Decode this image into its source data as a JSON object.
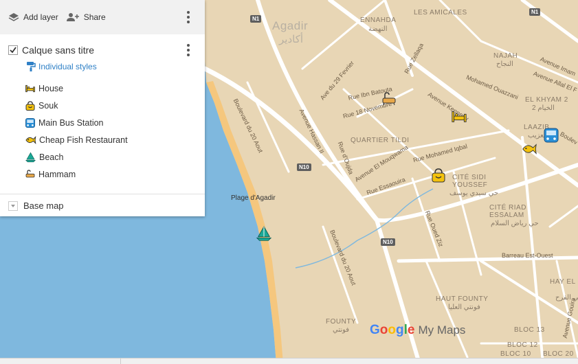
{
  "toolbar": {
    "add_layer_label": "Add layer",
    "share_label": "Share"
  },
  "layer": {
    "title": "Calque sans titre",
    "checked": true,
    "style_label": "Individual styles",
    "items": [
      {
        "label": "House",
        "icon": "bed-icon",
        "color": "#f4c20d"
      },
      {
        "label": "Souk",
        "icon": "shopping-bag-icon",
        "color": "#f4c20d"
      },
      {
        "label": "Main Bus Station",
        "icon": "bus-icon",
        "color": "#2a8fd6"
      },
      {
        "label": "Cheap Fish Restaurant",
        "icon": "fish-icon",
        "color": "#f4c20d"
      },
      {
        "label": "Beach",
        "icon": "sailboat-icon",
        "color": "#1aa896"
      },
      {
        "label": "Hammam",
        "icon": "bath-icon",
        "color": "#e8a84a"
      }
    ]
  },
  "base_map_label": "Base map",
  "map": {
    "city_name": "Agadir",
    "city_name_ar": "أكادير",
    "beach_label": "Plage d'Agadir",
    "route_shields": [
      "N1",
      "N1",
      "N10",
      "N10"
    ],
    "districts": [
      {
        "name": "ENNAHDA",
        "ar": "النهضة"
      },
      {
        "name": "LES AMICALES",
        "ar": ""
      },
      {
        "name": "NAJAH",
        "ar": "النجاح"
      },
      {
        "name": "EL KHYAM 2",
        "ar": "الخيام 2"
      },
      {
        "name": "LAAZIB",
        "ar": "لعزيب"
      },
      {
        "name": "QUARTIER TILDI",
        "ar": ""
      },
      {
        "name": "CITÉ SIDI YOUSSEF",
        "ar": "حي سيدي يوسف"
      },
      {
        "name": "CITÉ RIAD ESSALAM",
        "ar": "حي رياض السلام"
      },
      {
        "name": "HAUT FOUNTY",
        "ar": "فونتي العليا"
      },
      {
        "name": "FOUNTY",
        "ar": "فونتي"
      },
      {
        "name": "HAY EL FARAH",
        "ar": "حي الفرح"
      },
      {
        "name": "BLOC 12",
        "ar": ""
      },
      {
        "name": "BLOC 13",
        "ar": ""
      },
      {
        "name": "BLOC 10",
        "ar": ""
      },
      {
        "name": "BLOC 20",
        "ar": ""
      }
    ],
    "streets": [
      "Rue Zellaqa",
      "Ave du 29 Fevrier",
      "Rue Ibn Batouta",
      "Rue 18 Novembre",
      "Avenue Imam",
      "Avenue Allal El Fassi",
      "Mohamed Ouazzani",
      "Avenue Kennedy",
      "Boulevard du 20 Aout",
      "Avenue Hassan II",
      "Rue d'Oujda",
      "Avenue El Mouqwama",
      "Rue Mohamed Iqbal",
      "Rue Essaouira",
      "Rue Oued Ziz",
      "Boulevard du 20 Aout",
      "Barreau Est-Ouest",
      "Avenue Gouira",
      "Boulev"
    ],
    "watermark_brand": "Google",
    "watermark_product": "My Maps"
  }
}
